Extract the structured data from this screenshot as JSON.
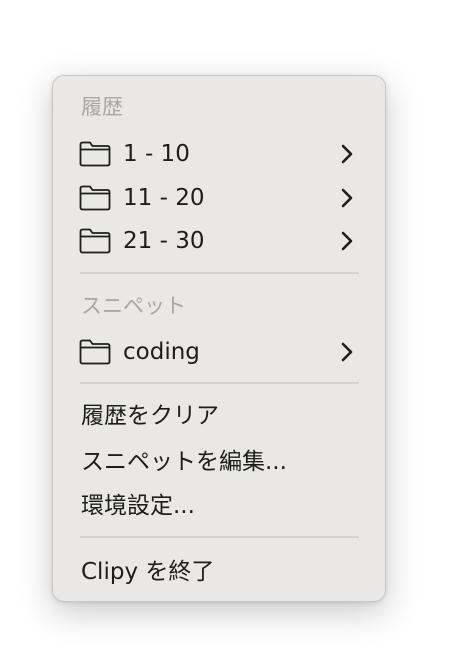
{
  "menu": {
    "history_header": "履歴",
    "history_folders": [
      {
        "label": "1 - 10",
        "icon": "folder-icon"
      },
      {
        "label": "11 - 20",
        "icon": "folder-icon"
      },
      {
        "label": "21 - 30",
        "icon": "folder-icon"
      }
    ],
    "snippets_header": "スニペット",
    "snippet_folders": [
      {
        "label": "coding",
        "icon": "folder-icon"
      }
    ],
    "actions": {
      "clear_history": "履歴をクリア",
      "edit_snippets": "スニペットを編集...",
      "preferences": "環境設定...",
      "quit": "Clipy を終了"
    }
  },
  "colors": {
    "menu_background": "#e9e8e6",
    "header_text": "#a7a6a4",
    "item_text": "#1d1d1d",
    "separator": "#d4d3d1"
  }
}
